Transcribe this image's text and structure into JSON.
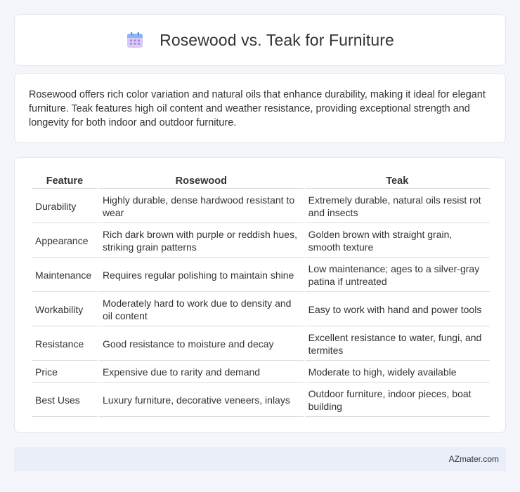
{
  "header": {
    "title": "Rosewood vs. Teak for Furniture",
    "icon": "calendar-icon",
    "icon_colors": {
      "top": "#8ab4f8",
      "body": "#d9c9f5",
      "grid": "#a47de0"
    }
  },
  "intro": {
    "text": "Rosewood offers rich color variation and natural oils that enhance durability, making it ideal for elegant furniture. Teak features high oil content and weather resistance, providing exceptional strength and longevity for both indoor and outdoor furniture."
  },
  "table": {
    "headers": [
      "Feature",
      "Rosewood",
      "Teak"
    ],
    "rows": [
      {
        "feature": "Durability",
        "rosewood": "Highly durable, dense hardwood resistant to wear",
        "teak": "Extremely durable, natural oils resist rot and insects"
      },
      {
        "feature": "Appearance",
        "rosewood": "Rich dark brown with purple or reddish hues, striking grain patterns",
        "teak": "Golden brown with straight grain, smooth texture"
      },
      {
        "feature": "Maintenance",
        "rosewood": "Requires regular polishing to maintain shine",
        "teak": "Low maintenance; ages to a silver-gray patina if untreated"
      },
      {
        "feature": "Workability",
        "rosewood": "Moderately hard to work due to density and oil content",
        "teak": "Easy to work with hand and power tools"
      },
      {
        "feature": "Resistance",
        "rosewood": "Good resistance to moisture and decay",
        "teak": "Excellent resistance to water, fungi, and termites"
      },
      {
        "feature": "Price",
        "rosewood": "Expensive due to rarity and demand",
        "teak": "Moderate to high, widely available"
      },
      {
        "feature": "Best Uses",
        "rosewood": "Luxury furniture, decorative veneers, inlays",
        "teak": "Outdoor furniture, indoor pieces, boat building"
      }
    ]
  },
  "footer": {
    "text": "AZmater.com"
  }
}
